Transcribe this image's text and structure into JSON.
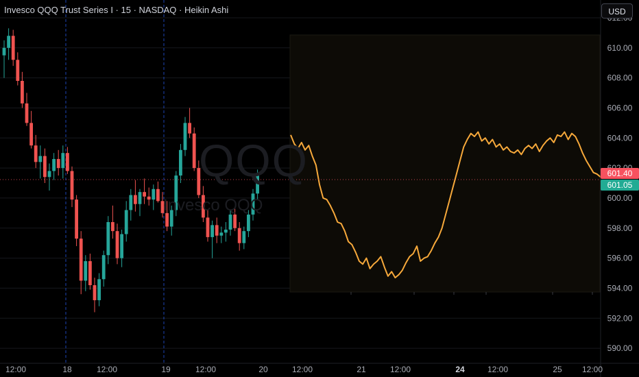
{
  "header": {
    "title": "Invesco QQQ Trust Series I · 15 · NASDAQ · Heikin Ashi",
    "currency_button": "USD"
  },
  "watermark": {
    "symbol": "QQQ",
    "name": "Invesco QQQ"
  },
  "price_tags": {
    "last": "601.40",
    "other": "601.05"
  },
  "colors": {
    "up": "#26a69a",
    "down": "#ef5350",
    "line": "#f7a93b",
    "crosshair": "#f7525f",
    "session_sep": "#2962ff",
    "grid": "#16181d"
  },
  "chart_data": [
    {
      "type": "candlestick",
      "style": "Heikin Ashi",
      "ylim": [
        589,
        612.5
      ],
      "y_ticks": [
        "590.00",
        "592.00",
        "594.00",
        "596.00",
        "598.00",
        "600.00",
        "602.00",
        "604.00",
        "606.00",
        "608.00",
        "610.00",
        "612.00"
      ],
      "x_ticks": [
        "12:00",
        "18",
        "12:00",
        "19",
        "12:00",
        "20"
      ],
      "session_dividers": [
        "18",
        "19"
      ],
      "candles": [
        [
          609.5,
          610.5,
          608,
          610
        ],
        [
          610,
          611.3,
          609.2,
          610.8
        ],
        [
          610.8,
          611.2,
          608.8,
          609.2
        ],
        [
          609.2,
          609.7,
          607.5,
          607.8
        ],
        [
          607.8,
          608.4,
          606,
          606.3
        ],
        [
          606.3,
          607,
          604.8,
          605
        ],
        [
          605,
          605.8,
          603.3,
          603.5
        ],
        [
          603.5,
          604.2,
          602,
          602.4
        ],
        [
          602.4,
          603.5,
          601.3,
          602.8
        ],
        [
          602.8,
          603.3,
          601,
          601.4
        ],
        [
          601.4,
          602.3,
          600.5,
          601.8
        ],
        [
          601.8,
          603,
          601.2,
          602.6
        ],
        [
          602.6,
          603.2,
          601.5,
          602
        ],
        [
          602,
          603.5,
          601.3,
          603
        ],
        [
          603,
          603.4,
          601.6,
          601.8
        ],
        [
          601.8,
          602.1,
          599.4,
          599.9
        ],
        [
          599.9,
          600.2,
          596.8,
          597.3
        ],
        [
          597.3,
          597.8,
          593.6,
          594.5
        ],
        [
          594.5,
          596.2,
          593.8,
          595.8
        ],
        [
          595.8,
          596.3,
          593.9,
          594.2
        ],
        [
          594.2,
          594.7,
          592.4,
          593.2
        ],
        [
          593.2,
          595,
          592.8,
          594.6
        ],
        [
          594.6,
          596.5,
          594.1,
          596.2
        ],
        [
          596.2,
          598.8,
          595.6,
          598.4
        ],
        [
          598.4,
          599.5,
          597.3,
          597.8
        ],
        [
          597.8,
          598.3,
          595.6,
          596
        ],
        [
          596,
          597.9,
          595.4,
          597.6
        ],
        [
          597.6,
          599.8,
          597.1,
          599.2
        ],
        [
          599.2,
          600.6,
          598.5,
          600.2
        ],
        [
          600.2,
          601.2,
          599.1,
          599.6
        ],
        [
          599.6,
          600.6,
          598.8,
          600.4
        ],
        [
          600.4,
          601.3,
          599.6,
          600.1
        ],
        [
          600.1,
          600.7,
          599.5,
          599.9
        ],
        [
          599.9,
          600.9,
          599.2,
          600.6
        ],
        [
          600.6,
          601.1,
          599.7,
          599.8
        ],
        [
          599.8,
          600.4,
          598.7,
          599
        ],
        [
          599,
          599.8,
          597.8,
          598.1
        ],
        [
          598.1,
          599.5,
          597.5,
          599.2
        ],
        [
          599.2,
          601.8,
          598.8,
          601.5
        ],
        [
          601.5,
          603.6,
          601,
          603.2
        ],
        [
          603.2,
          605.4,
          602.8,
          605
        ],
        [
          605,
          606,
          604,
          604.3
        ],
        [
          604.3,
          604.7,
          601.8,
          602
        ],
        [
          602,
          602.5,
          600,
          600.2
        ],
        [
          600.2,
          600.8,
          598.4,
          598.7
        ],
        [
          598.7,
          599.2,
          597.1,
          597.4
        ],
        [
          597.4,
          598.5,
          596,
          598.2
        ],
        [
          598.2,
          598.7,
          597,
          597.5
        ],
        [
          597.5,
          598.1,
          597,
          597.7
        ],
        [
          597.7,
          598.4,
          597.1,
          597.9
        ],
        [
          597.9,
          599.2,
          597.5,
          598.9
        ],
        [
          598.9,
          599.3,
          597.8,
          598
        ],
        [
          598,
          598.4,
          596.5,
          597
        ],
        [
          597,
          598.1,
          596.6,
          597.8
        ],
        [
          597.8,
          599.2,
          597.4,
          598.9
        ],
        [
          598.9,
          600.6,
          598.5,
          600.3
        ],
        [
          600.3,
          601.9,
          599.9,
          601.6
        ]
      ]
    },
    {
      "type": "line",
      "ylim": [
        589,
        612.5
      ],
      "x_ticks": [
        "12:00",
        "21",
        "12:00",
        "24",
        "12:00",
        "25",
        "12:00"
      ],
      "values": [
        604.2,
        603.6,
        603.3,
        603.7,
        603.2,
        603.5,
        602.8,
        602.2,
        600.9,
        600,
        599.9,
        599.5,
        599,
        598.4,
        598.3,
        597.8,
        597.1,
        596.9,
        596.4,
        595.8,
        595.6,
        596,
        595.3,
        595.6,
        595.8,
        596.1,
        595.4,
        594.8,
        595.1,
        594.7,
        594.9,
        595.2,
        595.7,
        596.1,
        596.3,
        596.8,
        595.8,
        596,
        596.1,
        596.5,
        597,
        597.4,
        598,
        598.9,
        599.8,
        600.7,
        601.6,
        602.5,
        603.4,
        603.9,
        604.3,
        604.1,
        604.4,
        603.8,
        604,
        603.6,
        603.9,
        603.4,
        603.6,
        603.2,
        603.4,
        603.1,
        603,
        603.2,
        602.9,
        603.3,
        603.5,
        603.3,
        603.6,
        603.1,
        603.5,
        603.8,
        604,
        603.7,
        604.2,
        604.1,
        604.4,
        603.9,
        604.3,
        604.1,
        603.6,
        603,
        602.5,
        602.1,
        601.7,
        601.6,
        601.4
      ]
    }
  ]
}
